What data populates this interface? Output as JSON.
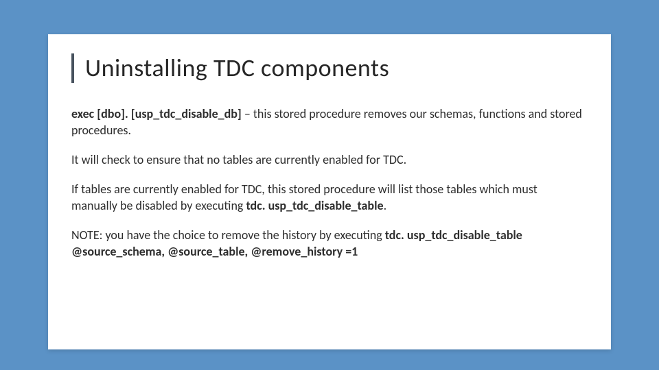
{
  "title": "Uninstalling TDC components",
  "p1": {
    "bold": "exec [dbo]. [usp_tdc_disable_db]",
    "rest": " – this stored procedure removes our schemas, functions and stored procedures."
  },
  "p2": "It will check to ensure that no tables are currently enabled for TDC.",
  "p3": {
    "lead": "If tables are currently enabled for TDC, this stored procedure will list those tables which must manually be disabled by executing ",
    "bold": "tdc. usp_tdc_disable_table",
    "tail": "."
  },
  "p4": {
    "lead": "NOTE: you have the choice to remove the history by executing ",
    "bold": "tdc. usp_tdc_disable_table @source_schema, @source_table, @remove_history =1"
  }
}
